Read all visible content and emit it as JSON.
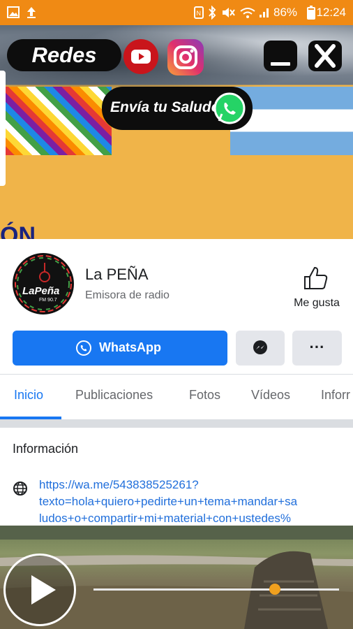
{
  "status_bar": {
    "battery": "86%",
    "time": "12:24"
  },
  "banner": {
    "redes_label": "Redes",
    "saludo_label": "Envía tu Saludo",
    "partial_text": "ÓN"
  },
  "page": {
    "name": "La PEÑA",
    "category": "Emisora de radio",
    "logo_text": "LaPeña",
    "logo_freq": "FM 90.7",
    "like_label": "Me gusta"
  },
  "actions": {
    "whatsapp_label": "WhatsApp",
    "more_label": "···"
  },
  "tabs": [
    "Inicio",
    "Publicaciones",
    "Fotos",
    "Vídeos",
    "Inforr"
  ],
  "info": {
    "heading": "Información",
    "link_lines": [
      "https://wa.me/543838525261?",
      "texto=hola+quiero+pedirte+un+tema+mandar+sa",
      "ludos+o+compartir+mi+material+con+ustedes%"
    ]
  },
  "player": {
    "progress": 0.74
  },
  "colors": {
    "status": "#f08a14",
    "accent": "#1877f2",
    "tab_active": "#1877f2",
    "slider": "#f0a01e"
  }
}
